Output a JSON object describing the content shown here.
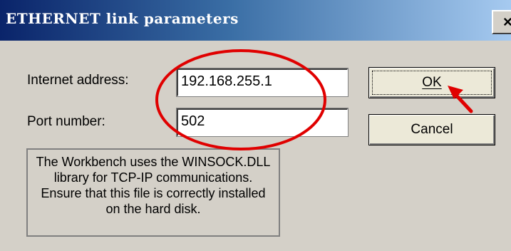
{
  "window": {
    "title": "ETHERNET link parameters",
    "close_glyph": "×"
  },
  "form": {
    "internet_address_label": "Internet address:",
    "internet_address_value": "192.168.255.1",
    "port_number_label": "Port number:",
    "port_number_value": "502"
  },
  "buttons": {
    "ok_label": "OK",
    "cancel_label": "Cancel"
  },
  "info": {
    "text": "The Workbench uses the WINSOCK.DLL library for TCP-IP communications. Ensure that this file is correctly installed on the hard disk."
  },
  "annotation": {
    "highlight_color": "#e00000"
  },
  "icons": [
    "close-icon",
    "arrow-icon"
  ]
}
